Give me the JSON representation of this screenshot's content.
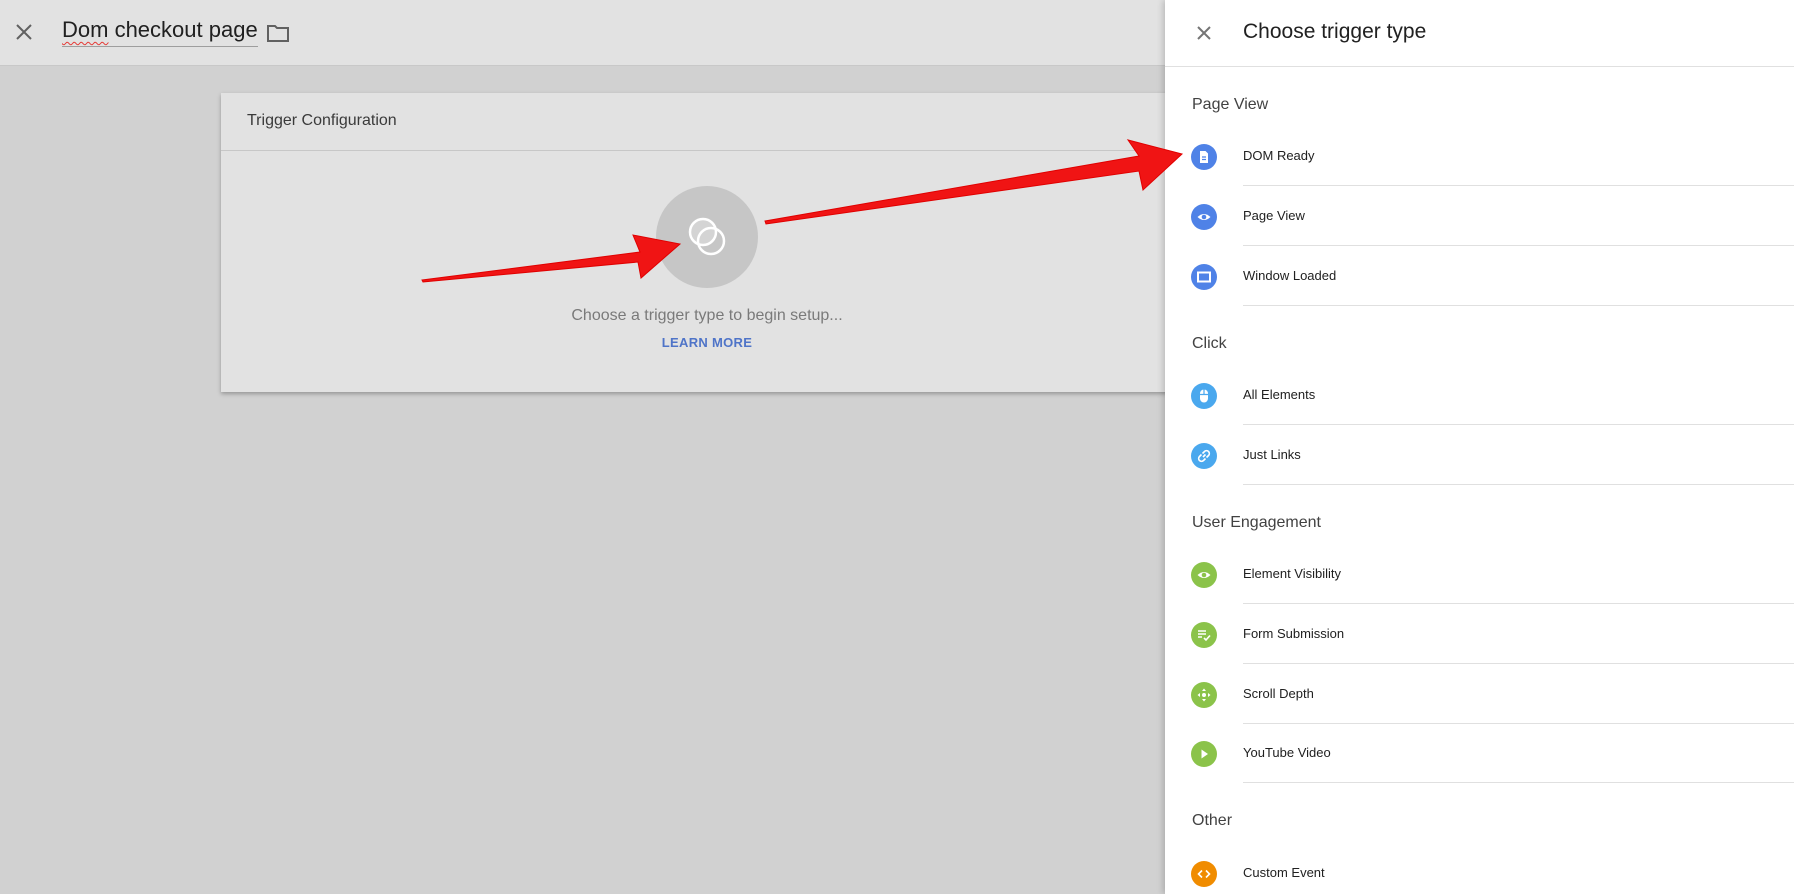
{
  "topbar": {
    "title_part1": "Dom",
    "title_part2": " checkout page"
  },
  "card": {
    "header": "Trigger Configuration",
    "hint": "Choose a trigger type to begin setup...",
    "learn_more": "LEARN MORE"
  },
  "panel": {
    "title": "Choose trigger type",
    "sections": {
      "page_view": "Page View",
      "click": "Click",
      "user_engagement": "User Engagement",
      "other": "Other"
    },
    "items": {
      "dom_ready": "DOM Ready",
      "page_view": "Page View",
      "window_loaded": "Window Loaded",
      "all_elements": "All Elements",
      "just_links": "Just Links",
      "element_visibility": "Element Visibility",
      "form_submission": "Form Submission",
      "scroll_depth": "Scroll Depth",
      "youtube_video": "YouTube Video",
      "custom_event": "Custom Event"
    }
  },
  "icons": {
    "dom_ready": "document-icon",
    "page_view": "eye-icon",
    "window_loaded": "window-icon",
    "all_elements": "mouse-icon",
    "just_links": "link-icon",
    "element_visibility": "eye-icon",
    "form_submission": "checklist-icon",
    "scroll_depth": "move-arrows-icon",
    "youtube_video": "play-icon",
    "custom_event": "code-icon"
  },
  "colors": {
    "page_view_group": "#4f82e7",
    "click_group": "#4aa8ee",
    "user_engagement_group": "#8bc34a",
    "other_group": "#f08c00",
    "annotation_arrow": "#f01414",
    "link": "#4f74c8"
  }
}
